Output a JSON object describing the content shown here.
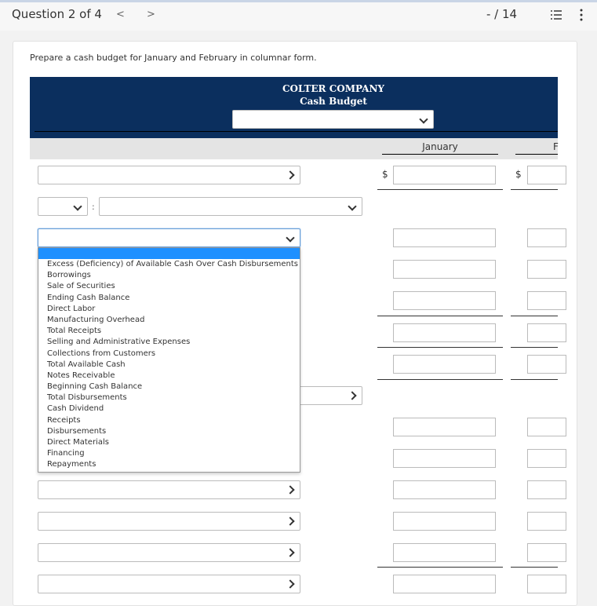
{
  "topbar": {
    "question_label": "Question 2 of 4",
    "prev_icon": "chevron-left-icon",
    "next_icon": "chevron-right-icon",
    "score": "- / 14",
    "list_icon": "list-icon",
    "more_icon": "more-vertical-icon"
  },
  "prompt": "Prepare a cash budget for January and February in columnar form.",
  "budget": {
    "company": "COLTER COMPANY",
    "title": "Cash Budget",
    "period_select": {
      "value": ""
    },
    "columns": [
      "January",
      "February"
    ],
    "currency_symbol": "$"
  },
  "rows": [
    {
      "type": "select",
      "value": "",
      "dollar": true,
      "rule_below": true
    },
    {
      "type": "select-pair",
      "value_left": "",
      "value_right": ""
    },
    {
      "type": "select",
      "value": "",
      "focused": true
    },
    {
      "type": "select",
      "value": ""
    },
    {
      "type": "select",
      "value": ""
    },
    {
      "type": "select",
      "value": ""
    },
    {
      "type": "select",
      "value": ""
    },
    {
      "type": "select",
      "value": ""
    },
    {
      "type": "select",
      "value": ""
    },
    {
      "type": "select",
      "value": ""
    },
    {
      "type": "select",
      "value": ""
    }
  ],
  "dropdown": {
    "options": [
      "",
      "Excess (Deficiency) of Available Cash Over Cash Disbursements",
      "Borrowings",
      "Sale of Securities",
      "Ending Cash Balance",
      "Direct Labor",
      "Manufacturing Overhead",
      "Total Receipts",
      "Selling and Administrative Expenses",
      "Collections from Customers",
      "Total Available Cash",
      "Notes Receivable",
      "Beginning Cash Balance",
      "Total Disbursements",
      "Cash Dividend",
      "Receipts",
      "Disbursements",
      "Direct Materials",
      "Financing",
      "Repayments"
    ]
  },
  "colors": {
    "header_band": "#0b2f5e",
    "highlight": "#1e90ff",
    "column_header_band": "#e4e4e4"
  }
}
